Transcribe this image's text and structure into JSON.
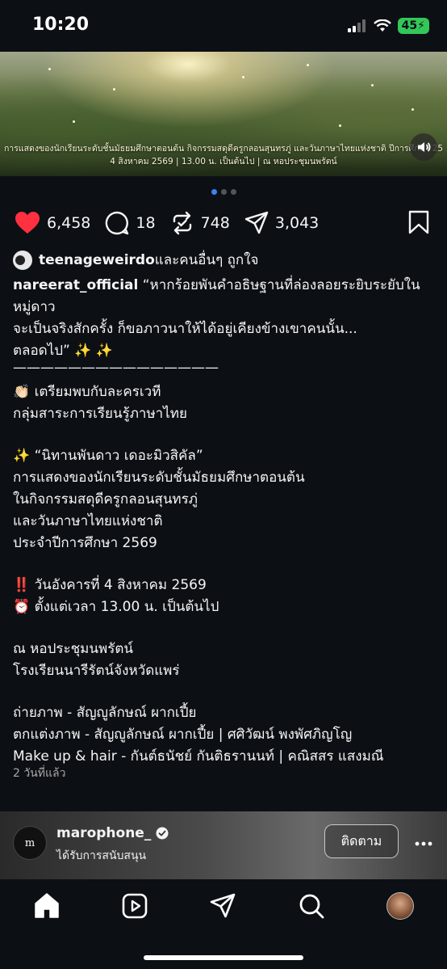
{
  "status_bar": {
    "time": "10:20",
    "battery": "45"
  },
  "media": {
    "caption_line1": "การแสดงของนักเรียนระดับชั้นมัธยมศึกษาตอนต้น กิจกรรมสดุดีครูกลอนสุนทรภู่ และวันภาษาไทยแห่งชาติ ปีการศึกษา 25",
    "caption_line2": "4 สิงหาคม 2569  |  13.00 น. เป็นต้นไป  |  ณ หอประชุมนพรัตน์",
    "sound_icon": "speaker-icon"
  },
  "actions": {
    "likes": "6,458",
    "comments": "18",
    "reposts": "748",
    "shares": "3,043"
  },
  "liked_by": {
    "user": "teenageweirdo",
    "rest": " และคนอื่นๆ ถูกใจ"
  },
  "caption": {
    "username": "nareerat_official",
    "lines": [
      " “หากร้อยพันคำอธิษฐานที่ล่องลอยระยิบระยับในหมู่ดาว",
      "จะเป็นจริงสักครั้ง ก็ขอภาวนาให้ได้อยู่เคียงข้างเขาคนนั้น...",
      "ตลอดไป” ✨ ✨",
      "———————————————",
      "👏🏻 เตรียมพบกับละครเวที",
      "กลุ่มสาระการเรียนรู้ภาษาไทย",
      "✨ “นิทานพันดาว เดอะมิวสิคัล”",
      "การแสดงของนักเรียนระดับชั้นมัธยมศึกษาตอนต้น",
      "ในกิจกรรมสดุดีครูกลอนสุนทรภู่",
      "และวันภาษาไทยแห่งชาติ",
      "ประจำปีการศึกษา 2569",
      " ‼️ วันอังคารที่ 4 สิงหาคม 2569",
      " ⏰ ตั้งแต่เวลา 13.00 น. เป็นต้นไป",
      " ณ หอประชุมนพรัตน์",
      "โรงเรียนนารีรัตน์จังหวัดแพร่",
      "ถ่ายภาพ - สัญญูลักษณ์  ผากเปี้ย",
      "ตกแต่งภาพ - สัญญูลักษณ์ ผากเปี้ย | ศศิวัฒน์ พงพัศภิญโญ",
      "Make up & hair - กันต์ธนัชย์  กันติธรานนท์ | คณิสสร แสงมณี"
    ],
    "timestamp": "2 วันที่แล้ว"
  },
  "next_post": {
    "avatar_text": "m",
    "username": "marophone_",
    "sponsored": "ได้รับการสนับสนุน",
    "follow_label": "ติดตาม"
  },
  "colors": {
    "accent": "#3b82f6",
    "like": "#ff3040",
    "background": "#0c1014"
  }
}
